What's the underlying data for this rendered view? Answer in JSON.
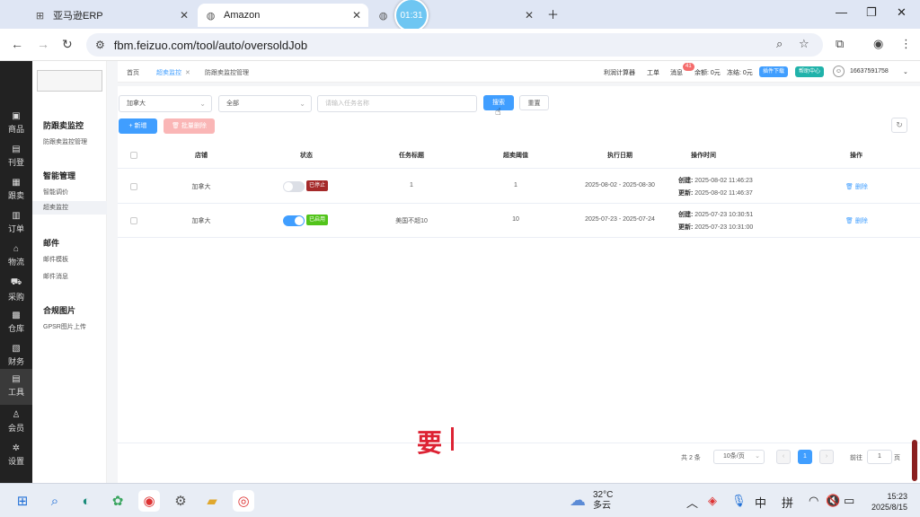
{
  "browser": {
    "tabs": [
      {
        "title": "亚马逊ERP",
        "active": false
      },
      {
        "title": "Amazon",
        "active": true
      },
      {
        "title": "",
        "active": false
      }
    ],
    "timer": "01:31",
    "url": "fbm.feizuo.com/tool/auto/oversoldJob"
  },
  "darknav": {
    "items": [
      {
        "label": "商品",
        "icon": "box-icon"
      },
      {
        "label": "刊登",
        "icon": "publish-icon"
      },
      {
        "label": "跟卖",
        "icon": "follow-icon"
      },
      {
        "label": "订单",
        "icon": "order-icon"
      },
      {
        "label": "物流",
        "icon": "home-icon"
      },
      {
        "label": "采购",
        "icon": "cart-icon"
      },
      {
        "label": "仓库",
        "icon": "warehouse-icon"
      },
      {
        "label": "财务",
        "icon": "finance-icon"
      },
      {
        "label": "工具",
        "icon": "tool-icon"
      },
      {
        "label": "会员",
        "icon": "user-icon"
      },
      {
        "label": "设置",
        "icon": "gear-icon"
      }
    ],
    "active_index": 8
  },
  "submenu": {
    "groups": [
      {
        "title": "防跟卖监控",
        "items": [
          "防跟卖监控管理"
        ]
      },
      {
        "title": "智能管理",
        "items": [
          "智能调价",
          "超卖监控"
        ]
      },
      {
        "title": "邮件",
        "items": [
          "邮件模板",
          "邮件消息"
        ]
      },
      {
        "title": "合规图片",
        "items": [
          "GPSR图片上传"
        ]
      }
    ],
    "active_item": "超卖监控"
  },
  "topbar": {
    "crumbs": [
      "首页",
      "超卖监控",
      "防跟卖监控管理"
    ],
    "right": {
      "calc": "利润计算器",
      "ticket": "工单",
      "msg": "消息",
      "msg_count": "41",
      "balance": "余额: 0元",
      "frozen": "冻结: 0元",
      "plugin": "插件下载",
      "help": "帮助中心",
      "phone": "16637591758"
    }
  },
  "filters": {
    "country": "加拿大",
    "status": "全部",
    "task_placeholder": "请输入任务名称",
    "search": "搜索",
    "reset": "重置",
    "add": "+ 新增",
    "batch_delete": "批量删除"
  },
  "table": {
    "headers": [
      "店铺",
      "状态",
      "任务标题",
      "超卖阈值",
      "执行日期",
      "操作时间",
      "操作"
    ],
    "rows": [
      {
        "shop": "加拿大",
        "enabled": false,
        "status": "已停止",
        "title": "1",
        "threshold": "1",
        "date": "2025-08-02 - 2025-08-30",
        "created_label": "创建:",
        "created": "2025-08-02 11:46:23",
        "updated_label": "更新:",
        "updated": "2025-08-02 11:46:37",
        "action": "删除"
      },
      {
        "shop": "加拿大",
        "enabled": true,
        "status": "已启用",
        "title": "美国不超10",
        "threshold": "10",
        "date": "2025-07-23 - 2025-07-24",
        "created_label": "创建:",
        "created": "2025-07-23 10:30:51",
        "updated_label": "更新:",
        "updated": "2025-07-23 10:31:00",
        "action": "删除"
      }
    ]
  },
  "pagination": {
    "total": "共 2 条",
    "page_size": "10条/页",
    "current": "1",
    "goto_prefix": "前往",
    "goto_value": "1",
    "goto_suffix": "页"
  },
  "overlay_text": "要",
  "taskbar": {
    "weather_temp": "32°C",
    "weather_desc": "多云",
    "ime_lang": "中",
    "ime_mode": "拼",
    "time": "15:23",
    "date": "2025/8/15"
  },
  "colors": {
    "primary": "#409eff",
    "stopped": "#a52a2a",
    "enabled": "#52c41a",
    "plugin": "#409eff",
    "help": "#20b2aa"
  }
}
